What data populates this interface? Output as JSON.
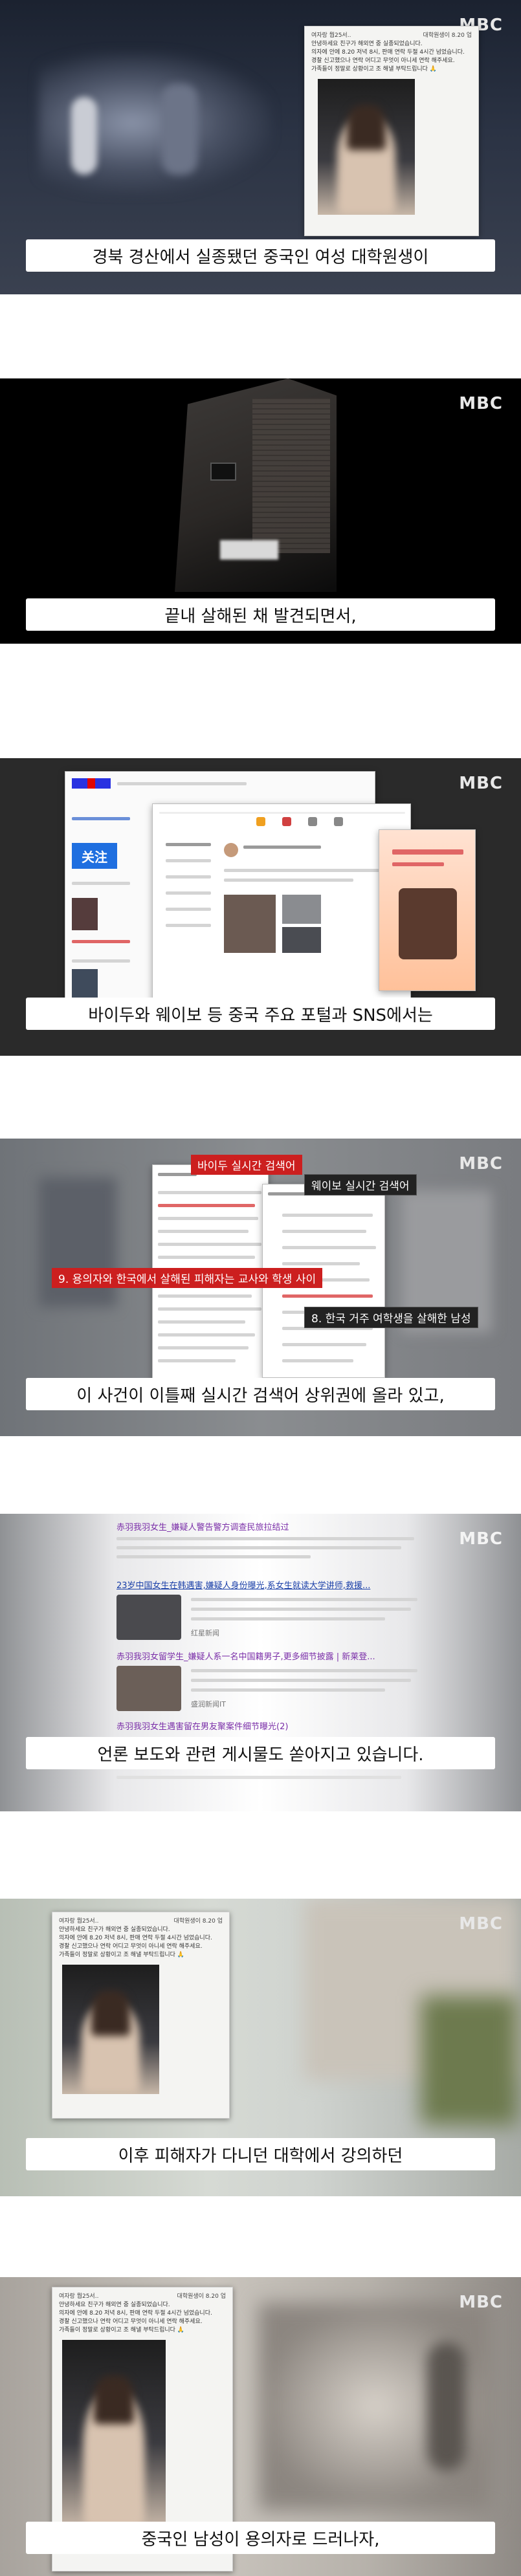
{
  "brand": {
    "logo": "MBC"
  },
  "post": {
    "author": "여자랑 뭡25서..",
    "time": "대학원생이 8.20 업",
    "lines": [
      "안녕하세요 친구가 해외연 중 실종되었습니다.",
      "의자에 안에 8.20 저녁 8시, 판매 연락 두절 4시간 넘었습니다.",
      "경찰 신고했으나 연락 어디고 무엇이 아니세 연락 해주세요.",
      "가족들이 정말로 상황이고 조 해낼 부탁드립니다 🙏"
    ]
  },
  "frames": [
    {
      "subtitle": "경북 경산에서 실종됐던 중국인 여성 대학원생이"
    },
    {
      "subtitle": "끝내 살해된 채 발견되면서,"
    },
    {
      "subtitle": "바이두와 웨이보 등 중국 주요 포털과 SNS에서는"
    },
    {
      "subtitle": "이 사건이 이틀째 실시간 검색어 상위권에 올라 있고,"
    },
    {
      "subtitle": "언론 보도와 관련 게시물도 쏟아지고 있습니다."
    },
    {
      "subtitle": "이후 피해자가 다니던 대학에서 강의하던"
    },
    {
      "subtitle": "중국인 남성이 용의자로 드러나자,"
    }
  ],
  "frame3": {
    "follow_button": "关注"
  },
  "frame4": {
    "baidu_label": "바이두 실시간 검색어",
    "weibo_label": "웨이보 실시간 검색어",
    "baidu_item": "9. 용의자와 한국에서 살해된 피해자는 교사와 학생 사이",
    "weibo_item": "8. 한국 거주 여학생을 살해한 남성"
  },
  "frame5": {
    "headlines": [
      "赤羽我羽女生_嫌疑人警告警方调查民旅拉结过",
      "23岁中国女生在韩遇害,嫌疑人身份曝光,系女生就读大学讲师,救援...",
      "赤羽我羽女留学生_嫌疑人系一名中国籍男子,更多细节披露 | 新莱登...",
      "赤羽我羽女生遇害留在男友聚案件细节曝光(2)"
    ],
    "sources": [
      "红星新闻",
      "盛润新闻IT"
    ]
  },
  "colors": {
    "subtitle_bg": "#ffffff",
    "subtitle_text": "#111111",
    "red_tag": "#cc1f1f",
    "link_purple": "#7a2ea8",
    "link_blue": "#1a3fa8"
  }
}
